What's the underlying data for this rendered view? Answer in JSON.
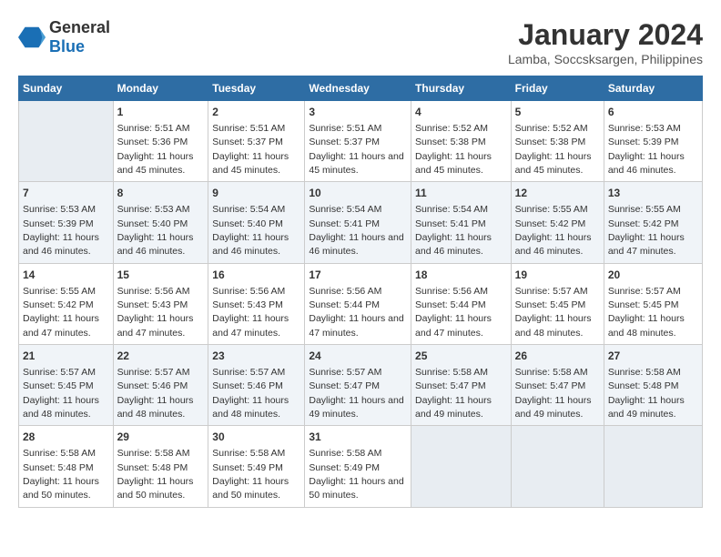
{
  "logo": {
    "general": "General",
    "blue": "Blue"
  },
  "title": "January 2024",
  "subtitle": "Lamba, Soccsksargen, Philippines",
  "days_of_week": [
    "Sunday",
    "Monday",
    "Tuesday",
    "Wednesday",
    "Thursday",
    "Friday",
    "Saturday"
  ],
  "weeks": [
    [
      {
        "day": "",
        "sunrise": "",
        "sunset": "",
        "daylight": ""
      },
      {
        "day": "1",
        "sunrise": "Sunrise: 5:51 AM",
        "sunset": "Sunset: 5:36 PM",
        "daylight": "Daylight: 11 hours and 45 minutes."
      },
      {
        "day": "2",
        "sunrise": "Sunrise: 5:51 AM",
        "sunset": "Sunset: 5:37 PM",
        "daylight": "Daylight: 11 hours and 45 minutes."
      },
      {
        "day": "3",
        "sunrise": "Sunrise: 5:51 AM",
        "sunset": "Sunset: 5:37 PM",
        "daylight": "Daylight: 11 hours and 45 minutes."
      },
      {
        "day": "4",
        "sunrise": "Sunrise: 5:52 AM",
        "sunset": "Sunset: 5:38 PM",
        "daylight": "Daylight: 11 hours and 45 minutes."
      },
      {
        "day": "5",
        "sunrise": "Sunrise: 5:52 AM",
        "sunset": "Sunset: 5:38 PM",
        "daylight": "Daylight: 11 hours and 45 minutes."
      },
      {
        "day": "6",
        "sunrise": "Sunrise: 5:53 AM",
        "sunset": "Sunset: 5:39 PM",
        "daylight": "Daylight: 11 hours and 46 minutes."
      }
    ],
    [
      {
        "day": "7",
        "sunrise": "Sunrise: 5:53 AM",
        "sunset": "Sunset: 5:39 PM",
        "daylight": "Daylight: 11 hours and 46 minutes."
      },
      {
        "day": "8",
        "sunrise": "Sunrise: 5:53 AM",
        "sunset": "Sunset: 5:40 PM",
        "daylight": "Daylight: 11 hours and 46 minutes."
      },
      {
        "day": "9",
        "sunrise": "Sunrise: 5:54 AM",
        "sunset": "Sunset: 5:40 PM",
        "daylight": "Daylight: 11 hours and 46 minutes."
      },
      {
        "day": "10",
        "sunrise": "Sunrise: 5:54 AM",
        "sunset": "Sunset: 5:41 PM",
        "daylight": "Daylight: 11 hours and 46 minutes."
      },
      {
        "day": "11",
        "sunrise": "Sunrise: 5:54 AM",
        "sunset": "Sunset: 5:41 PM",
        "daylight": "Daylight: 11 hours and 46 minutes."
      },
      {
        "day": "12",
        "sunrise": "Sunrise: 5:55 AM",
        "sunset": "Sunset: 5:42 PM",
        "daylight": "Daylight: 11 hours and 46 minutes."
      },
      {
        "day": "13",
        "sunrise": "Sunrise: 5:55 AM",
        "sunset": "Sunset: 5:42 PM",
        "daylight": "Daylight: 11 hours and 47 minutes."
      }
    ],
    [
      {
        "day": "14",
        "sunrise": "Sunrise: 5:55 AM",
        "sunset": "Sunset: 5:42 PM",
        "daylight": "Daylight: 11 hours and 47 minutes."
      },
      {
        "day": "15",
        "sunrise": "Sunrise: 5:56 AM",
        "sunset": "Sunset: 5:43 PM",
        "daylight": "Daylight: 11 hours and 47 minutes."
      },
      {
        "day": "16",
        "sunrise": "Sunrise: 5:56 AM",
        "sunset": "Sunset: 5:43 PM",
        "daylight": "Daylight: 11 hours and 47 minutes."
      },
      {
        "day": "17",
        "sunrise": "Sunrise: 5:56 AM",
        "sunset": "Sunset: 5:44 PM",
        "daylight": "Daylight: 11 hours and 47 minutes."
      },
      {
        "day": "18",
        "sunrise": "Sunrise: 5:56 AM",
        "sunset": "Sunset: 5:44 PM",
        "daylight": "Daylight: 11 hours and 47 minutes."
      },
      {
        "day": "19",
        "sunrise": "Sunrise: 5:57 AM",
        "sunset": "Sunset: 5:45 PM",
        "daylight": "Daylight: 11 hours and 48 minutes."
      },
      {
        "day": "20",
        "sunrise": "Sunrise: 5:57 AM",
        "sunset": "Sunset: 5:45 PM",
        "daylight": "Daylight: 11 hours and 48 minutes."
      }
    ],
    [
      {
        "day": "21",
        "sunrise": "Sunrise: 5:57 AM",
        "sunset": "Sunset: 5:45 PM",
        "daylight": "Daylight: 11 hours and 48 minutes."
      },
      {
        "day": "22",
        "sunrise": "Sunrise: 5:57 AM",
        "sunset": "Sunset: 5:46 PM",
        "daylight": "Daylight: 11 hours and 48 minutes."
      },
      {
        "day": "23",
        "sunrise": "Sunrise: 5:57 AM",
        "sunset": "Sunset: 5:46 PM",
        "daylight": "Daylight: 11 hours and 48 minutes."
      },
      {
        "day": "24",
        "sunrise": "Sunrise: 5:57 AM",
        "sunset": "Sunset: 5:47 PM",
        "daylight": "Daylight: 11 hours and 49 minutes."
      },
      {
        "day": "25",
        "sunrise": "Sunrise: 5:58 AM",
        "sunset": "Sunset: 5:47 PM",
        "daylight": "Daylight: 11 hours and 49 minutes."
      },
      {
        "day": "26",
        "sunrise": "Sunrise: 5:58 AM",
        "sunset": "Sunset: 5:47 PM",
        "daylight": "Daylight: 11 hours and 49 minutes."
      },
      {
        "day": "27",
        "sunrise": "Sunrise: 5:58 AM",
        "sunset": "Sunset: 5:48 PM",
        "daylight": "Daylight: 11 hours and 49 minutes."
      }
    ],
    [
      {
        "day": "28",
        "sunrise": "Sunrise: 5:58 AM",
        "sunset": "Sunset: 5:48 PM",
        "daylight": "Daylight: 11 hours and 50 minutes."
      },
      {
        "day": "29",
        "sunrise": "Sunrise: 5:58 AM",
        "sunset": "Sunset: 5:48 PM",
        "daylight": "Daylight: 11 hours and 50 minutes."
      },
      {
        "day": "30",
        "sunrise": "Sunrise: 5:58 AM",
        "sunset": "Sunset: 5:49 PM",
        "daylight": "Daylight: 11 hours and 50 minutes."
      },
      {
        "day": "31",
        "sunrise": "Sunrise: 5:58 AM",
        "sunset": "Sunset: 5:49 PM",
        "daylight": "Daylight: 11 hours and 50 minutes."
      },
      {
        "day": "",
        "sunrise": "",
        "sunset": "",
        "daylight": ""
      },
      {
        "day": "",
        "sunrise": "",
        "sunset": "",
        "daylight": ""
      },
      {
        "day": "",
        "sunrise": "",
        "sunset": "",
        "daylight": ""
      }
    ]
  ]
}
